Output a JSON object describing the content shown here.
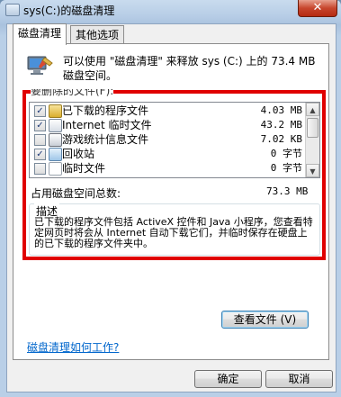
{
  "window": {
    "title": "sys(C:)的磁盘清理",
    "close_glyph": "✕"
  },
  "tabs": [
    {
      "label": "磁盘清理",
      "active": true
    },
    {
      "label": "其他选项",
      "active": false
    }
  ],
  "header": {
    "icon": "computer-cleanup-icon",
    "text": "可以使用 \"磁盘清理\" 来释放 sys (C:) 上的 73.4 MB 磁盘空间。"
  },
  "files_list": {
    "label": "要删除的文件(F):",
    "items": [
      {
        "name": "已下载的程序文件",
        "size": "4.03 MB",
        "checked": true,
        "icon": "program-files-icon"
      },
      {
        "name": "Internet 临时文件",
        "size": "43.2 MB",
        "checked": true,
        "icon": "internet-files-icon"
      },
      {
        "name": "游戏统计信息文件",
        "size": "7.02 KB",
        "checked": false,
        "icon": "game-stats-icon"
      },
      {
        "name": "回收站",
        "size": "0 字节",
        "checked": true,
        "icon": "recycle-bin-icon"
      },
      {
        "name": "临时文件",
        "size": "0 字节",
        "checked": false,
        "icon": "temp-files-icon"
      }
    ]
  },
  "total": {
    "label": "占用磁盘空间总数:",
    "value": "73.3 MB"
  },
  "description": {
    "title": "描述",
    "text": "已下载的程序文件包括 ActiveX 控件和 Java 小程序，您查看特定网页时将会从 Internet 自动下载它们，并临时保存在硬盘上的已下载的程序文件夹中。"
  },
  "buttons": {
    "view_files": "查看文件 (V)",
    "help_link": "磁盘清理如何工作?",
    "ok": "确定",
    "cancel": "取消"
  },
  "colors": {
    "highlight_box": "#e00000",
    "link": "#0066cc"
  }
}
